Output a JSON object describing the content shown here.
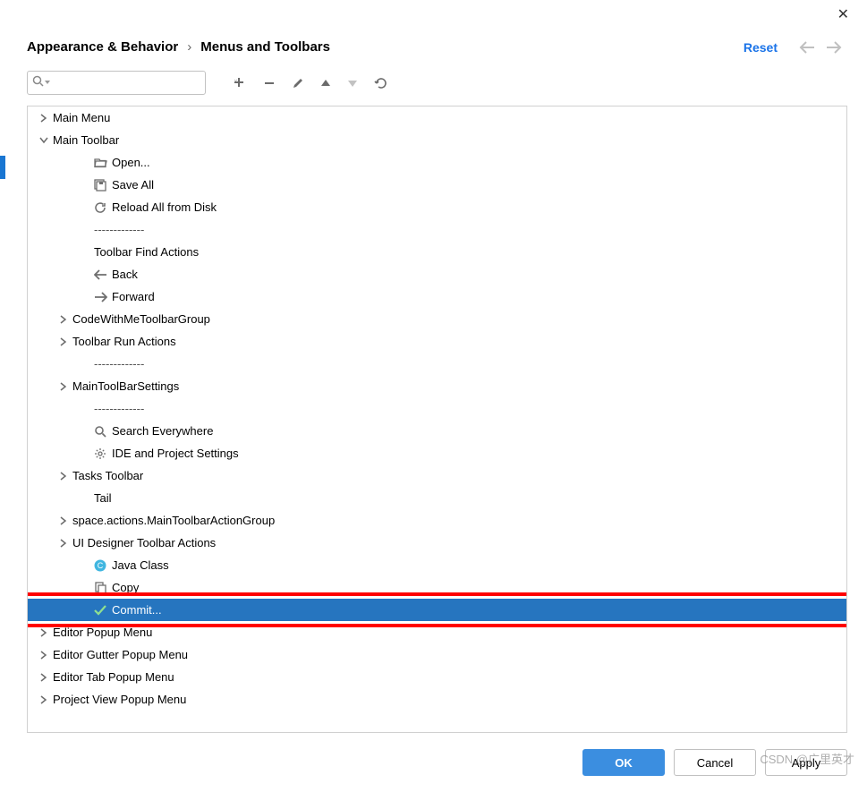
{
  "titlebar": {
    "close": "✕"
  },
  "breadcrumb": {
    "parent": "Appearance & Behavior",
    "sep": "›",
    "current": "Menus and Toolbars"
  },
  "header": {
    "reset": "Reset"
  },
  "search": {
    "placeholder": ""
  },
  "separator_text": "-------------",
  "tree": [
    {
      "d": 0,
      "arrow": "right",
      "label": "Main Menu"
    },
    {
      "d": 0,
      "arrow": "down",
      "label": "Main Toolbar"
    },
    {
      "d": 2,
      "icon": "folder-open",
      "label": "Open..."
    },
    {
      "d": 2,
      "icon": "save-all",
      "label": "Save All"
    },
    {
      "d": 2,
      "icon": "reload",
      "label": "Reload All from Disk"
    },
    {
      "d": 2,
      "sep": true
    },
    {
      "d": 2,
      "label": "Toolbar Find Actions"
    },
    {
      "d": 2,
      "icon": "arrow-left",
      "label": "Back"
    },
    {
      "d": 2,
      "icon": "arrow-right",
      "label": "Forward"
    },
    {
      "d": 1,
      "arrow": "right",
      "label": "CodeWithMeToolbarGroup"
    },
    {
      "d": 1,
      "arrow": "right",
      "label": "Toolbar Run Actions"
    },
    {
      "d": 2,
      "sep": true
    },
    {
      "d": 1,
      "arrow": "right",
      "label": "MainToolBarSettings"
    },
    {
      "d": 2,
      "sep": true
    },
    {
      "d": 2,
      "icon": "search",
      "label": "Search Everywhere"
    },
    {
      "d": 2,
      "icon": "gear",
      "label": "IDE and Project Settings"
    },
    {
      "d": 1,
      "arrow": "right",
      "label": "Tasks Toolbar"
    },
    {
      "d": 2,
      "label": "Tail"
    },
    {
      "d": 1,
      "arrow": "right",
      "label": "space.actions.MainToolbarActionGroup"
    },
    {
      "d": 1,
      "arrow": "right",
      "label": "UI Designer Toolbar Actions"
    },
    {
      "d": 2,
      "icon": "java-class",
      "label": "Java Class"
    },
    {
      "d": 2,
      "icon": "copy",
      "label": "Copy"
    },
    {
      "d": 2,
      "icon": "check",
      "label": "Commit...",
      "selected": true
    },
    {
      "d": 0,
      "arrow": "right",
      "label": "Editor Popup Menu"
    },
    {
      "d": 0,
      "arrow": "right",
      "label": "Editor Gutter Popup Menu"
    },
    {
      "d": 0,
      "arrow": "right",
      "label": "Editor Tab Popup Menu"
    },
    {
      "d": 0,
      "arrow": "right",
      "label": "Project View Popup Menu"
    }
  ],
  "footer": {
    "ok": "OK",
    "cancel": "Cancel",
    "apply": "Apply"
  },
  "watermark": "CSDN @广里英才"
}
